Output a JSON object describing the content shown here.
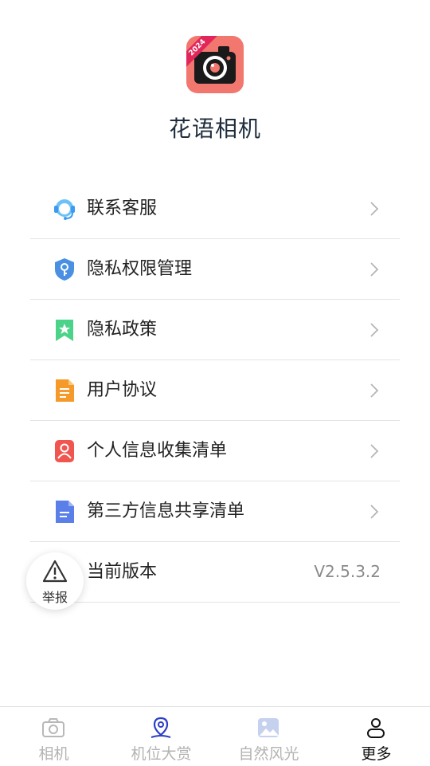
{
  "app": {
    "name": "花语相机",
    "icon_badge": "2024"
  },
  "menu": [
    {
      "label": "联系客服",
      "icon": "customer-service-icon",
      "color": "#3b9bf0"
    },
    {
      "label": "隐私权限管理",
      "icon": "shield-key-icon",
      "color": "#4a90e2"
    },
    {
      "label": "隐私政策",
      "icon": "bookmark-star-icon",
      "color": "#4cd38a"
    },
    {
      "label": "用户协议",
      "icon": "document-icon",
      "color": "#f59a2a"
    },
    {
      "label": "个人信息收集清单",
      "icon": "person-card-icon",
      "color": "#f0554f"
    },
    {
      "label": "第三方信息共享清单",
      "icon": "file-icon",
      "color": "#5b7fe8"
    },
    {
      "label": "当前版本",
      "value": "V2.5.3.2"
    }
  ],
  "report": {
    "label": "举报"
  },
  "tabs": [
    {
      "label": "相机",
      "icon": "camera-icon"
    },
    {
      "label": "机位大赏",
      "icon": "location-pin-icon"
    },
    {
      "label": "自然风光",
      "icon": "landscape-photo-icon"
    },
    {
      "label": "更多",
      "icon": "person-icon",
      "active": true
    }
  ]
}
